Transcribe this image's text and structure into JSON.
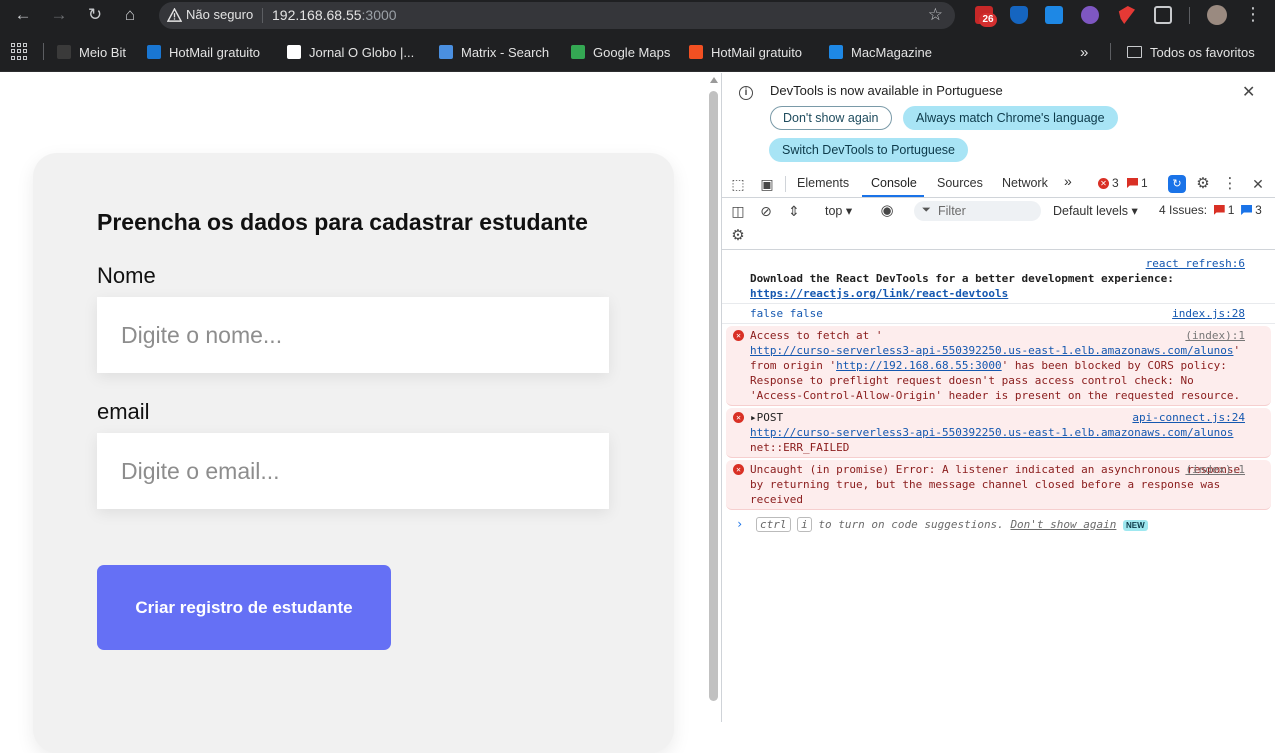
{
  "browser": {
    "security_label": "Não seguro",
    "url_host": "192.168.68.55",
    "url_port": ":3000",
    "extension_badge": "26",
    "bookmarks": [
      {
        "label": "Meio Bit",
        "color": "#3a3a3a"
      },
      {
        "label": "HotMail gratuito",
        "color": "#1976d2"
      },
      {
        "label": "Jornal O Globo |...",
        "color": "#ffffff"
      },
      {
        "label": "Matrix - Search",
        "color": "#4a8fe0"
      },
      {
        "label": "Google Maps",
        "color": "#34a853"
      },
      {
        "label": "HotMail gratuito",
        "color": "#f25022"
      },
      {
        "label": "MacMagazine",
        "color": "#1e88e5"
      }
    ],
    "all_bookmarks": "Todos os favoritos"
  },
  "form": {
    "title": "Preencha os dados para cadastrar estudante",
    "name_label": "Nome",
    "name_placeholder": "Digite o nome...",
    "email_label": "email",
    "email_placeholder": "Digite o email...",
    "submit_label": "Criar registro de estudante",
    "accent": "#6570f5"
  },
  "devtools": {
    "info": {
      "text": "DevTools is now available in Portuguese",
      "dont_show": "Don't show again",
      "match_lang": "Always match Chrome's language",
      "switch": "Switch DevTools to Portuguese"
    },
    "tabs": [
      "Elements",
      "Console",
      "Sources",
      "Network"
    ],
    "active_tab": "Console",
    "errors_count": "3",
    "warnings_count": "1",
    "context": "top",
    "filter_placeholder": "Filter",
    "levels": "Default levels",
    "issues_label": "4 Issues:",
    "issues_errors": "1",
    "issues_info": "3",
    "messages": {
      "m1_src": "react refresh:6",
      "m1_text": "Download the React DevTools for a better development experience:",
      "m1_link": "https://reactjs.org/link/react-devtools",
      "m2_text": "false false",
      "m2_src": "index.js:28",
      "m3_src": "(index):1",
      "m3_a": "Access to fetch at '",
      "m3_url": "http://curso-serverless3-api-550392250.us-east-1.elb.amazonaws.com/alunos",
      "m3_b": "' from origin '",
      "m3_origin": "http://192.168.68.55:3000",
      "m3_c": "' has been blocked by CORS policy: Response to preflight request doesn't pass access control check: No 'Access-Control-Allow-Origin' header is present on the requested resource.",
      "m4_src": "api-connect.js:24",
      "m4_method": "POST",
      "m4_url": "http://curso-serverless3-api-550392250.us-east-1.elb.amazonaws.com/alunos",
      "m4_err": "net::ERR_FAILED",
      "m5_src": "(index):1",
      "m5_text": "Uncaught (in promise) Error: A listener indicated an asynchronous response by returning true, but the message channel closed before a response was received",
      "prompt_ctrl": "ctrl",
      "prompt_i": "i",
      "prompt_text": "to turn on code suggestions.",
      "prompt_dont": "Don't show again",
      "prompt_new": "NEW"
    }
  }
}
